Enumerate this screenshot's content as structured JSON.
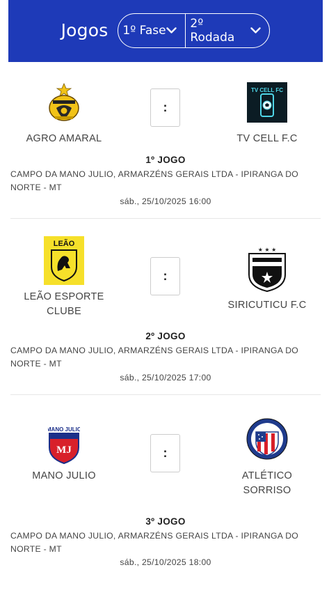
{
  "header": {
    "title": "Jogos",
    "phase": "1º Fase",
    "round": "2º Rodada",
    "bg_color": "#1e3ab8"
  },
  "games": [
    {
      "number": "1º JOGO",
      "home": {
        "name": "AGRO AMARAL",
        "logo": "agro-amaral-crest"
      },
      "away": {
        "name": "TV CELL F.C",
        "logo": "tv-cell-crest"
      },
      "score_separator": ":",
      "venue": "CAMPO DA MANO JULIO, ARMARZÉNS GERAIS LTDA - IPIRANGA DO NORTE - MT",
      "datetime": "sáb., 25/10/2025 16:00"
    },
    {
      "number": "2º JOGO",
      "home": {
        "name": "LEÃO ESPORTE CLUBE",
        "logo": "leao-crest"
      },
      "away": {
        "name": "SIRICUTICU F.C",
        "logo": "siricuticu-crest"
      },
      "score_separator": ":",
      "venue": "CAMPO DA MANO JULIO, ARMARZÉNS GERAIS LTDA - IPIRANGA DO NORTE - MT",
      "datetime": "sáb., 25/10/2025 17:00"
    },
    {
      "number": "3º JOGO",
      "home": {
        "name": "MANO JULIO",
        "logo": "mano-julio-crest"
      },
      "away": {
        "name": "ATLÉTICO SORRISO",
        "logo": "atletico-sorriso-crest"
      },
      "score_separator": ":",
      "venue": "CAMPO DA MANO JULIO, ARMARZÉNS GERAIS LTDA - IPIRANGA DO NORTE - MT",
      "datetime": "sáb., 25/10/2025 18:00"
    }
  ]
}
